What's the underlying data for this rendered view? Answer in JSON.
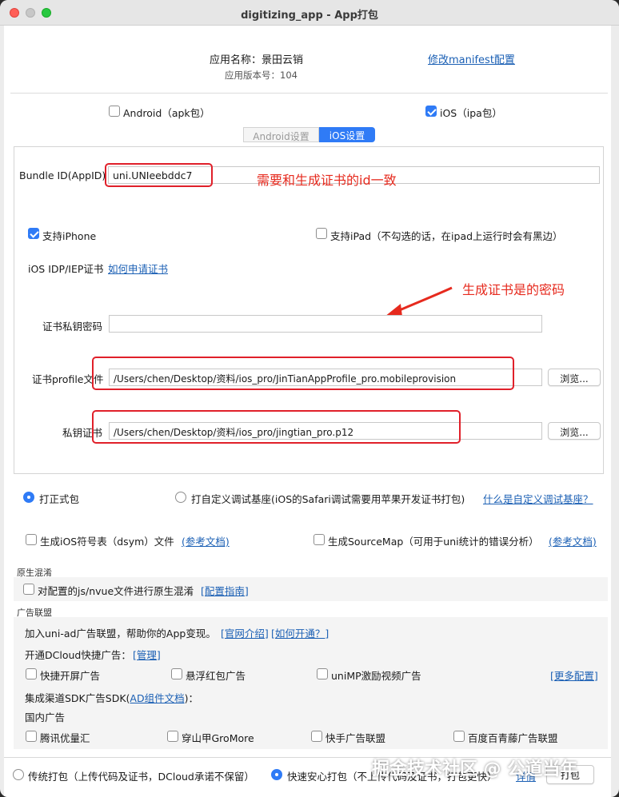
{
  "window": {
    "title": "digitizing_app - App打包"
  },
  "header": {
    "app_name": "应用名称：景田云销",
    "app_version": "应用版本号：104",
    "manifest_link": "修改manifest配置"
  },
  "platforms": {
    "android_label": "Android（apk包）",
    "ios_label": "iOS（ipa包）"
  },
  "tabs": {
    "android": "Android设置",
    "ios": "iOS设置"
  },
  "ios": {
    "bundle_label": "Bundle ID(AppID)",
    "bundle_value": "uni.UNIeebddc7",
    "bundle_note": "需要和生成证书的id一致",
    "iphone_label": "支持iPhone",
    "ipad_label": "支持iPad（不勾选的话，在ipad上运行时会有黑边）",
    "cert_label": "iOS IDP/IEP证书",
    "cert_link": "如何申请证书",
    "password_note": "生成证书是的密码",
    "password_label": "证书私钥密码",
    "profile_label": "证书profile文件",
    "profile_value": "/Users/chen/Desktop/资料/ios_pro/JinTianAppProfile_pro.mobileprovision",
    "p12_label": "私钥证书",
    "p12_value": "/Users/chen/Desktop/资料/ios_pro/jingtian_pro.p12",
    "browse": "浏览..."
  },
  "build_type": {
    "formal": "打正式包",
    "custom": "打自定义调试基座(iOS的Safari调试需要用苹果开发证书打包)",
    "custom_link": "什么是自定义调试基座？"
  },
  "options": {
    "dsym": "生成iOS符号表（dsym）文件",
    "dsym_link": "(参考文档)",
    "sourcemap": "生成SourceMap（可用于uni统计的错误分析）",
    "sourcemap_link": "(参考文档)"
  },
  "obfuscation": {
    "title": "原生混淆",
    "label": "对配置的js/nvue文件进行原生混淆",
    "link": "[配置指南]"
  },
  "ads": {
    "title": "广告联盟",
    "intro": "加入uni-ad广告联盟，帮助你的App变现。",
    "intro_link1": "[官网介绍]",
    "intro_link2": "[如何开通？]",
    "quick_label": "开通DCloud快捷广告：",
    "quick_link": "[管理]",
    "splash": "快捷开屏广告",
    "redpack": "悬浮红包广告",
    "video": "uniMP激励视频广告",
    "more_link": "[更多配置]",
    "sdk_label_pre": "集成渠道SDK广告SDK(",
    "sdk_link": "AD组件文档",
    "sdk_label_post": ")：",
    "domestic": "国内广告",
    "tencent": "腾讯优量汇",
    "gromore": "穿山甲GroMore",
    "kuaishou": "快手广告联盟",
    "baidu": "百度百青藤广告联盟"
  },
  "footer": {
    "traditional": "传统打包（上传代码及证书，DCloud承诺不保留）",
    "fast": "快速安心打包（不上传代码及证书，打包更快）",
    "detail_link": "详情",
    "pack_button": "打包"
  },
  "watermark": "掘金技术社区 @ 公道当年"
}
